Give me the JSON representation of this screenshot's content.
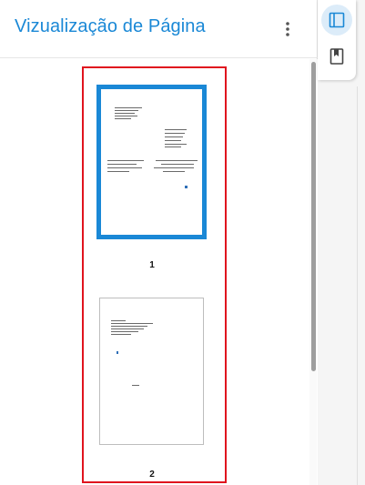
{
  "panel": {
    "title": "Vizualização de Página",
    "more_icon": "more-vertical-icon"
  },
  "pages": [
    {
      "number": "1",
      "selected": true
    },
    {
      "number": "2",
      "selected": false
    }
  ],
  "rail": {
    "items": [
      {
        "icon": "sidebar-panel-icon",
        "active": true
      },
      {
        "icon": "bookmark-icon",
        "active": false
      }
    ]
  },
  "colors": {
    "accent": "#1a88d6",
    "selection_frame": "#e0141e",
    "active_rail_bg": "#dcecf9"
  }
}
